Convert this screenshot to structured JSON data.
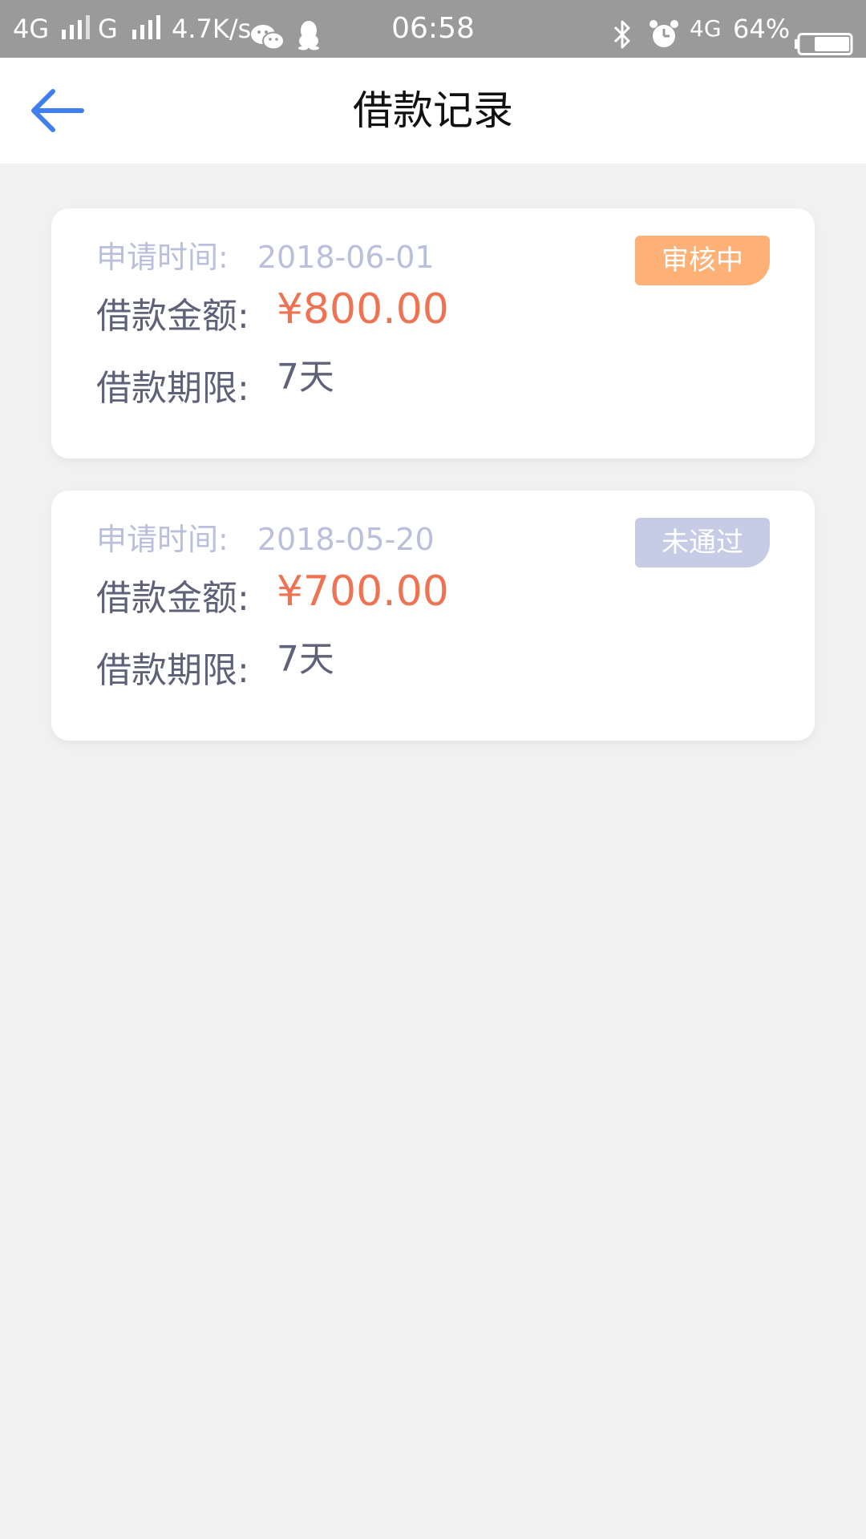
{
  "status_bar": {
    "net1": "4G",
    "net2": "G",
    "speed": "4.7K/s",
    "time": "06:58",
    "net3": "4G",
    "battery_pct": "64%"
  },
  "header": {
    "title": "借款记录"
  },
  "records": [
    {
      "date_label": "申请时间:",
      "date": "2018-06-01",
      "amount_label": "借款金额:",
      "amount": "¥800.00",
      "term_label": "借款期限:",
      "term": "7天",
      "status": "审核中",
      "status_color": "#fdb176"
    },
    {
      "date_label": "申请时间:",
      "date": "2018-05-20",
      "amount_label": "借款金额:",
      "amount": "¥700.00",
      "term_label": "借款期限:",
      "term": "7天",
      "status": "未通过",
      "status_color": "#c7cce6"
    }
  ],
  "icons": {
    "back": "arrow-left-icon",
    "wechat": "wechat-icon",
    "qq": "qq-penguin-icon",
    "bluetooth": "bluetooth-icon",
    "alarm": "alarm-clock-icon",
    "battery": "battery-icon"
  },
  "colors": {
    "accent": "#3f7ff0",
    "amount": "#ee7352"
  }
}
